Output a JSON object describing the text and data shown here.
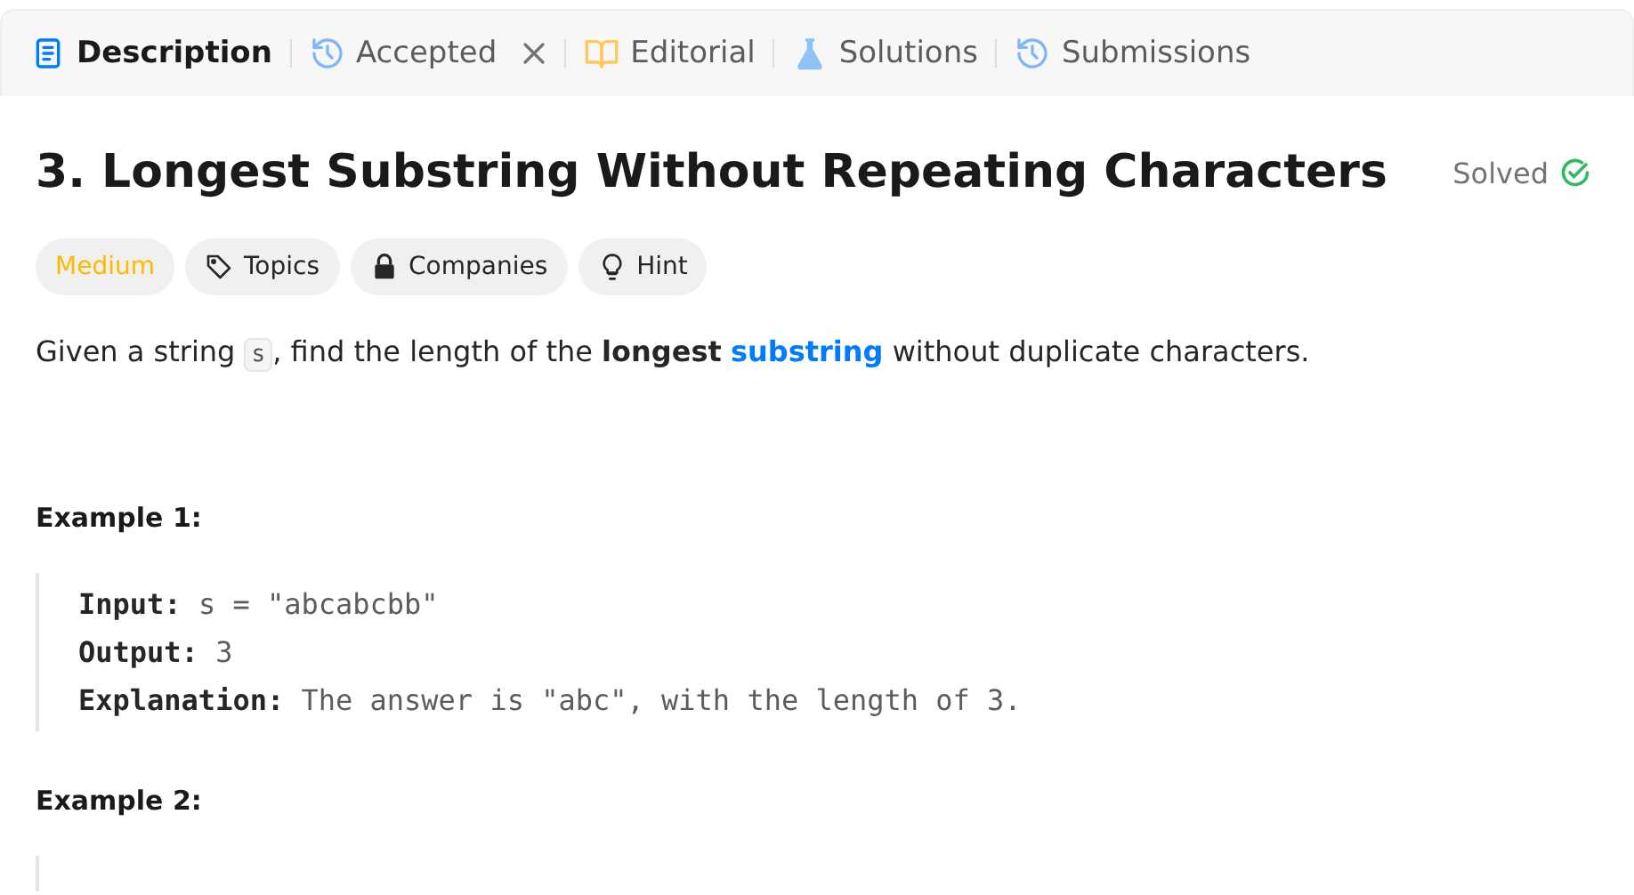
{
  "tabs": [
    {
      "label": "Description",
      "kind": "doc",
      "selected": true,
      "closable": false
    },
    {
      "label": "Accepted",
      "kind": "history",
      "selected": false,
      "closable": true
    },
    {
      "label": "Editorial",
      "kind": "book",
      "selected": false,
      "closable": false
    },
    {
      "label": "Solutions",
      "kind": "flask",
      "selected": false,
      "closable": false
    },
    {
      "label": "Submissions",
      "kind": "history",
      "selected": false,
      "closable": false
    }
  ],
  "problem": {
    "title": "3. Longest Substring Without Repeating Characters",
    "status": "Solved",
    "solved": true,
    "tags": [
      {
        "label": "Medium",
        "kind": "difficulty",
        "color": "#ffb800"
      },
      {
        "label": "Topics",
        "kind": "tag",
        "color": "#262626"
      },
      {
        "label": "Companies",
        "kind": "lock",
        "color": "#262626"
      },
      {
        "label": "Hint",
        "kind": "bulb",
        "color": "#262626"
      }
    ],
    "description": [
      {
        "kind": "text",
        "text": "Given a string "
      },
      {
        "kind": "code",
        "text": "s"
      },
      {
        "kind": "text",
        "text": ", find the length of the **longest** "
      },
      {
        "kind": "link",
        "text": "substring"
      },
      {
        "kind": "text",
        "text": " without duplicate characters."
      }
    ],
    "examples": [
      {
        "heading": "Example 1:",
        "lines": [
          {
            "label": "Input:",
            "value": "s = \"abcabcbb\""
          },
          {
            "label": "Output:",
            "value": "3"
          },
          {
            "label": "Explanation:",
            "value": "The answer is \"abc\", with the length of 3."
          }
        ]
      },
      {
        "heading": "Example 2:"
      }
    ]
  }
}
